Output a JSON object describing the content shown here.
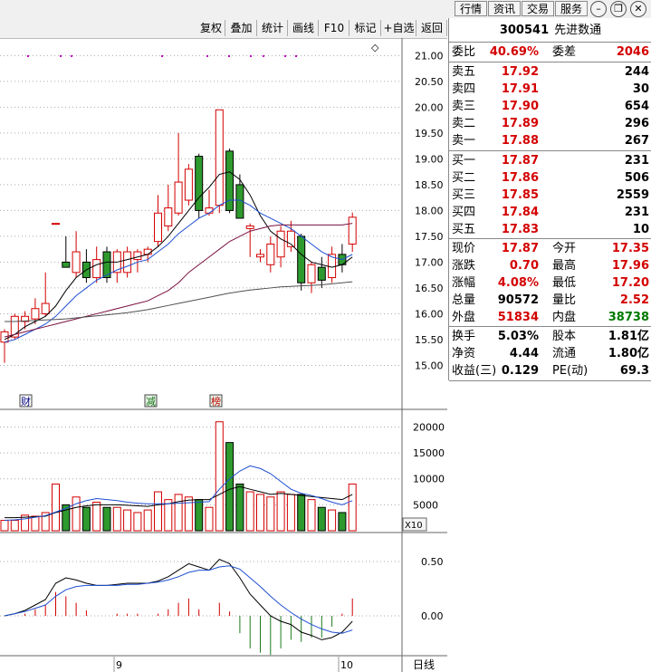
{
  "top_menu": [
    "行情",
    "资讯",
    "交易",
    "服务"
  ],
  "window_icons": [
    "minimize-icon",
    "restore-icon",
    "close-icon"
  ],
  "toolbar": [
    "复权",
    "叠加",
    "统计",
    "画线",
    "F10",
    "标记",
    "+自选",
    "返回"
  ],
  "stock": {
    "code": "300541",
    "name": "先进数通"
  },
  "weibi": {
    "label": "委比",
    "value": "40.69%",
    "diff_label": "委差",
    "diff": "2046"
  },
  "asks": [
    {
      "label": "卖五",
      "price": "17.92",
      "vol": "244"
    },
    {
      "label": "卖四",
      "price": "17.91",
      "vol": "30"
    },
    {
      "label": "卖三",
      "price": "17.90",
      "vol": "654"
    },
    {
      "label": "卖二",
      "price": "17.89",
      "vol": "296"
    },
    {
      "label": "卖一",
      "price": "17.88",
      "vol": "267"
    }
  ],
  "bids": [
    {
      "label": "买一",
      "price": "17.87",
      "vol": "231"
    },
    {
      "label": "买二",
      "price": "17.86",
      "vol": "506"
    },
    {
      "label": "买三",
      "price": "17.85",
      "vol": "2559"
    },
    {
      "label": "买四",
      "price": "17.84",
      "vol": "231"
    },
    {
      "label": "买五",
      "price": "17.83",
      "vol": "10"
    }
  ],
  "stats1": [
    {
      "l1": "现价",
      "v1": "17.87",
      "c1": "red",
      "l2": "今开",
      "v2": "17.35",
      "c2": "red"
    },
    {
      "l1": "涨跌",
      "v1": "0.70",
      "c1": "red",
      "l2": "最高",
      "v2": "17.96",
      "c2": "red"
    },
    {
      "l1": "涨幅",
      "v1": "4.08%",
      "c1": "red",
      "l2": "最低",
      "v2": "17.20",
      "c2": "red"
    },
    {
      "l1": "总量",
      "v1": "90572",
      "c1": "blk",
      "l2": "量比",
      "v2": "2.52",
      "c2": "red"
    },
    {
      "l1": "外盘",
      "v1": "51834",
      "c1": "red",
      "l2": "内盘",
      "v2": "38738",
      "c2": "grn"
    }
  ],
  "stats2": [
    {
      "l1": "换手",
      "v1": "5.03%",
      "l2": "股本",
      "v2": "1.81亿"
    },
    {
      "l1": "净资",
      "v1": "4.44",
      "l2": "流通",
      "v2": "1.80亿"
    },
    {
      "l1": "收益(三)",
      "v1": "0.129",
      "l2": "PE(动)",
      "v2": "69.3"
    }
  ],
  "markers": [
    "财",
    "减",
    "榜"
  ],
  "vol_unit": "X10",
  "x_labels": [
    "9",
    "10"
  ],
  "period": "日线",
  "chart_data": {
    "type": "candlestick",
    "price_axis": {
      "ticks": [
        15.0,
        15.5,
        16.0,
        16.5,
        17.0,
        17.5,
        18.0,
        18.5,
        19.0,
        19.5,
        20.0,
        20.5,
        21.0
      ],
      "ylim": [
        14.85,
        21.2
      ]
    },
    "candles": [
      {
        "o": 15.45,
        "c": 15.65,
        "h": 15.7,
        "l": 15.05
      },
      {
        "o": 15.55,
        "c": 15.95,
        "h": 16.0,
        "l": 15.5
      },
      {
        "o": 15.85,
        "c": 15.95,
        "h": 16.05,
        "l": 15.7
      },
      {
        "o": 15.9,
        "c": 16.1,
        "h": 16.3,
        "l": 15.8
      },
      {
        "o": 16.0,
        "c": 16.2,
        "h": 16.8,
        "l": 15.95
      },
      {
        "o": 17.75,
        "c": 17.75,
        "h": 17.75,
        "l": 17.75
      },
      {
        "o": 17.0,
        "c": 16.9,
        "h": 17.5,
        "l": 16.9
      },
      {
        "o": 16.8,
        "c": 17.2,
        "h": 17.6,
        "l": 16.7
      },
      {
        "o": 17.0,
        "c": 16.7,
        "h": 17.25,
        "l": 16.6
      },
      {
        "o": 16.7,
        "c": 17.05,
        "h": 17.3,
        "l": 16.6
      },
      {
        "o": 17.2,
        "c": 16.7,
        "h": 17.3,
        "l": 16.6
      },
      {
        "o": 16.8,
        "c": 17.2,
        "h": 17.25,
        "l": 16.6
      },
      {
        "o": 16.8,
        "c": 17.2,
        "h": 17.3,
        "l": 16.7
      },
      {
        "o": 17.05,
        "c": 17.2,
        "h": 17.25,
        "l": 16.8
      },
      {
        "o": 17.15,
        "c": 17.25,
        "h": 17.3,
        "l": 17.0
      },
      {
        "o": 17.4,
        "c": 17.95,
        "h": 18.3,
        "l": 17.3
      },
      {
        "o": 17.7,
        "c": 18.05,
        "h": 18.5,
        "l": 17.6
      },
      {
        "o": 17.95,
        "c": 18.55,
        "h": 19.5,
        "l": 17.9
      },
      {
        "o": 18.2,
        "c": 18.8,
        "h": 18.9,
        "l": 18.1
      },
      {
        "o": 19.05,
        "c": 18.0,
        "h": 19.1,
        "l": 17.85
      },
      {
        "o": 17.95,
        "c": 18.05,
        "h": 18.4,
        "l": 17.9
      },
      {
        "o": 18.1,
        "c": 19.95,
        "h": 19.95,
        "l": 17.95
      },
      {
        "o": 19.15,
        "c": 18.0,
        "h": 19.2,
        "l": 17.95
      },
      {
        "o": 18.5,
        "c": 17.85,
        "h": 18.7,
        "l": 17.85
      },
      {
        "o": 17.65,
        "c": 17.7,
        "h": 17.75,
        "l": 17.1
      },
      {
        "o": 17.1,
        "c": 17.15,
        "h": 17.25,
        "l": 17.0
      },
      {
        "o": 16.95,
        "c": 17.35,
        "h": 17.5,
        "l": 16.8
      },
      {
        "o": 17.1,
        "c": 17.6,
        "h": 17.7,
        "l": 16.9
      },
      {
        "o": 17.3,
        "c": 17.6,
        "h": 17.8,
        "l": 17.2
      },
      {
        "o": 17.5,
        "c": 16.6,
        "h": 17.55,
        "l": 16.45
      },
      {
        "o": 16.6,
        "c": 16.95,
        "h": 17.0,
        "l": 16.4
      },
      {
        "o": 16.9,
        "c": 16.65,
        "h": 17.1,
        "l": 16.5
      },
      {
        "o": 16.7,
        "c": 17.15,
        "h": 17.3,
        "l": 16.6
      },
      {
        "o": 17.15,
        "c": 16.95,
        "h": 17.35,
        "l": 16.8
      },
      {
        "o": 17.35,
        "c": 17.87,
        "h": 17.96,
        "l": 17.2
      }
    ],
    "ma_lines": [
      {
        "color": "#000000",
        "values": [
          15.5,
          15.6,
          15.75,
          15.85,
          15.95,
          16.15,
          16.45,
          16.7,
          16.85,
          16.95,
          17.0,
          17.0,
          17.05,
          17.1,
          17.15,
          17.3,
          17.5,
          17.75,
          18.0,
          18.25,
          18.45,
          18.7,
          18.75,
          18.6,
          18.3,
          17.9,
          17.6,
          17.45,
          17.35,
          17.15,
          17.0,
          16.95,
          16.9,
          16.95,
          17.1
        ]
      },
      {
        "color": "#1d4fd1",
        "values": [
          15.45,
          15.5,
          15.6,
          15.7,
          15.8,
          15.95,
          16.15,
          16.35,
          16.5,
          16.65,
          16.75,
          16.85,
          16.92,
          17.0,
          17.05,
          17.2,
          17.35,
          17.55,
          17.7,
          17.85,
          17.95,
          18.1,
          18.2,
          18.2,
          18.1,
          17.95,
          17.85,
          17.75,
          17.65,
          17.5,
          17.35,
          17.2,
          17.1,
          17.05,
          17.15
        ]
      },
      {
        "color": "#7a1040",
        "values": [
          15.55,
          15.6,
          15.65,
          15.7,
          15.75,
          15.8,
          15.85,
          15.9,
          15.95,
          16.0,
          16.05,
          16.1,
          16.15,
          16.2,
          16.25,
          16.35,
          16.45,
          16.6,
          16.8,
          16.95,
          17.1,
          17.25,
          17.4,
          17.5,
          17.6,
          17.65,
          17.7,
          17.72,
          17.72,
          17.72,
          17.72,
          17.72,
          17.72,
          17.72,
          17.75
        ]
      },
      {
        "color": "#505050",
        "values": [
          15.85,
          15.85,
          15.86,
          15.87,
          15.88,
          15.89,
          15.9,
          15.92,
          15.94,
          15.96,
          15.98,
          16.0,
          16.02,
          16.05,
          16.08,
          16.12,
          16.16,
          16.2,
          16.24,
          16.28,
          16.32,
          16.36,
          16.4,
          16.43,
          16.46,
          16.48,
          16.5,
          16.52,
          16.53,
          16.54,
          16.55,
          16.56,
          16.58,
          16.6,
          16.62
        ]
      }
    ],
    "volume_axis": {
      "ticks": [
        5000,
        10000,
        15000,
        20000
      ],
      "ylim": [
        0,
        22000
      ]
    },
    "volumes": [
      2000,
      2000,
      3000,
      2800,
      3500,
      9000,
      5000,
      6500,
      4500,
      5500,
      4500,
      4500,
      4000,
      3500,
      4000,
      7500,
      6000,
      7000,
      6500,
      6000,
      4500,
      21000,
      17000,
      9000,
      7500,
      7000,
      6500,
      7500,
      7000,
      7000,
      6000,
      4500,
      4000,
      3500,
      9000
    ],
    "vol_ma": [
      {
        "color": "#000000",
        "values": [
          2500,
          2500,
          2600,
          2700,
          2800,
          3500,
          4000,
          4500,
          4800,
          5000,
          5000,
          5000,
          4900,
          4800,
          4700,
          5000,
          5200,
          5600,
          5900,
          6000,
          6000,
          7000,
          8000,
          8500,
          8000,
          7500,
          7000,
          7200,
          7000,
          6800,
          6600,
          6400,
          6200,
          6000,
          7000
        ]
      },
      {
        "color": "#1d4fd1",
        "values": [
          2000,
          2100,
          2300,
          2600,
          2900,
          3600,
          4300,
          5200,
          5800,
          6200,
          6000,
          5800,
          5500,
          5300,
          5200,
          5200,
          5200,
          5300,
          5400,
          5500,
          5600,
          8000,
          10000,
          11500,
          12500,
          12000,
          11000,
          9500,
          8000,
          7200,
          6800,
          6200,
          5500,
          5000,
          5800
        ]
      }
    ],
    "macd_axis": {
      "ticks": [
        0.0,
        0.5
      ],
      "ylim": [
        -0.35,
        0.75
      ]
    },
    "macd_dif": [
      0.0,
      0.02,
      0.05,
      0.1,
      0.15,
      0.3,
      0.35,
      0.33,
      0.3,
      0.28,
      0.28,
      0.29,
      0.3,
      0.3,
      0.3,
      0.32,
      0.36,
      0.42,
      0.48,
      0.45,
      0.42,
      0.52,
      0.48,
      0.35,
      0.2,
      0.1,
      0.0,
      -0.05,
      -0.08,
      -0.15,
      -0.18,
      -0.22,
      -0.2,
      -0.15,
      -0.05
    ],
    "macd_dea": [
      0.0,
      0.02,
      0.04,
      0.07,
      0.1,
      0.18,
      0.24,
      0.27,
      0.28,
      0.28,
      0.28,
      0.28,
      0.29,
      0.29,
      0.3,
      0.31,
      0.33,
      0.36,
      0.4,
      0.42,
      0.42,
      0.45,
      0.46,
      0.43,
      0.35,
      0.27,
      0.18,
      0.1,
      0.03,
      -0.03,
      -0.08,
      -0.12,
      -0.15,
      -0.16,
      -0.13
    ],
    "macd_hist": [
      0.0,
      0.0,
      0.02,
      0.06,
      0.1,
      0.22,
      0.18,
      0.12,
      0.05,
      0.0,
      0.0,
      0.02,
      0.02,
      0.02,
      0.0,
      0.02,
      0.06,
      0.12,
      0.16,
      0.06,
      0.0,
      0.12,
      0.04,
      -0.16,
      -0.3,
      -0.34,
      -0.36,
      -0.3,
      -0.22,
      -0.24,
      -0.2,
      -0.2,
      -0.1,
      0.02,
      0.16
    ]
  }
}
